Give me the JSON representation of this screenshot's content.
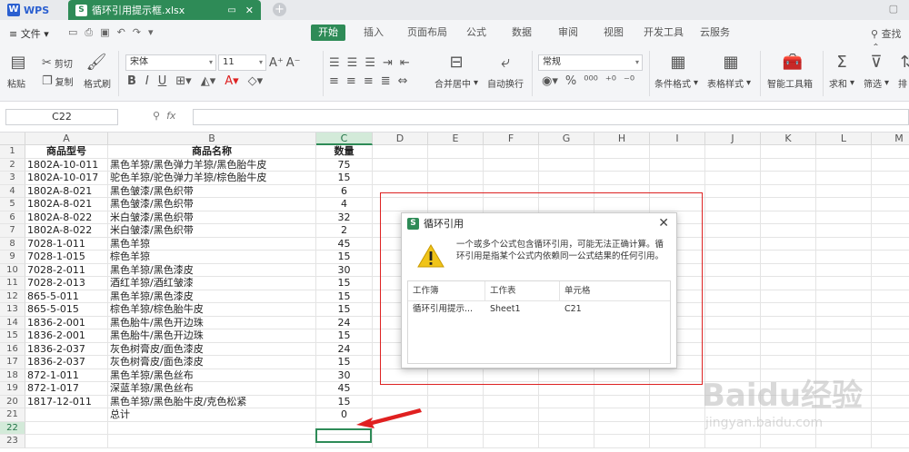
{
  "titlebar": {
    "app_name": "WPS",
    "doc_tab": "循环引用提示框.xlsx",
    "add_tab": "+"
  },
  "menubar": {
    "file": "文件",
    "tabs": [
      "开始",
      "插入",
      "页面布局",
      "公式",
      "数据",
      "审阅",
      "视图",
      "开发工具",
      "云服务"
    ],
    "active_tab": "开始",
    "search": "查找命"
  },
  "ribbon": {
    "cut": "剪切",
    "copy": "复制",
    "format_painter": "格式刷",
    "paste": "粘贴",
    "font_name": "宋体",
    "font_size": "11",
    "merge": "合并居中",
    "wrap": "自动换行",
    "number_format": "常规",
    "cond_format": "条件格式",
    "table_style": "表格样式",
    "smart_toolbox": "智能工具箱",
    "sum": "求和",
    "filter": "筛选",
    "sort": "排"
  },
  "formula_bar": {
    "name_box": "C22",
    "fx": "fx"
  },
  "sheet": {
    "columns": [
      "A",
      "B",
      "C",
      "D",
      "E",
      "F",
      "G",
      "H",
      "I",
      "J",
      "K",
      "L",
      "M"
    ],
    "row_numbers": [
      "1",
      "2",
      "3",
      "4",
      "5",
      "6",
      "7",
      "8",
      "9",
      "10",
      "11",
      "12",
      "13",
      "14",
      "15",
      "16",
      "17",
      "18",
      "19",
      "20",
      "21",
      "22",
      "23"
    ],
    "header": [
      "商品型号",
      "商品名称",
      "数量"
    ],
    "rows": [
      [
        "1802A-10-011",
        "黑色羊猄/黑色弹力羊猄/黑色胎牛皮",
        "75"
      ],
      [
        "1802A-10-017",
        "驼色羊猄/驼色弹力羊猄/棕色胎牛皮",
        "15"
      ],
      [
        "1802A-8-021",
        "黑色皱漆/黑色织带",
        "6"
      ],
      [
        "1802A-8-021",
        "黑色皱漆/黑色织带",
        "4"
      ],
      [
        "1802A-8-022",
        "米白皱漆/黑色织带",
        "32"
      ],
      [
        "1802A-8-022",
        "米白皱漆/黑色织带",
        "2"
      ],
      [
        "7028-1-011",
        "黑色羊猄",
        "45"
      ],
      [
        "7028-1-015",
        "棕色羊猄",
        "15"
      ],
      [
        "7028-2-011",
        "黑色羊猄/黑色漆皮",
        "30"
      ],
      [
        "7028-2-013",
        "酒红羊猄/酒红皱漆",
        "15"
      ],
      [
        "865-5-011",
        "黑色羊猄/黑色漆皮",
        "15"
      ],
      [
        "865-5-015",
        "棕色羊猄/棕色胎牛皮",
        "15"
      ],
      [
        "1836-2-001",
        "黑色胎牛/黑色开边珠",
        "24"
      ],
      [
        "1836-2-001",
        "黑色胎牛/黑色开边珠",
        "15"
      ],
      [
        "1836-2-037",
        "灰色树膏皮/面色漆皮",
        "24"
      ],
      [
        "1836-2-037",
        "灰色树膏皮/面色漆皮",
        "15"
      ],
      [
        "872-1-011",
        "黑色羊猄/黑色丝布",
        "30"
      ],
      [
        "872-1-017",
        "深蓝羊猄/黑色丝布",
        "45"
      ],
      [
        "1817-12-011",
        "黑色羊猄/黑色胎牛皮/克色松紧",
        "15"
      ]
    ],
    "total_label": "总计",
    "total_value": "0"
  },
  "dialog": {
    "title": "循环引用",
    "close": "✕",
    "message": "一个或多个公式包含循环引用，可能无法正确计算。循环引用是指某个公式内依赖同一公式结果的任何引用。",
    "table_headers": [
      "工作簿",
      "工作表",
      "单元格"
    ],
    "table_row": [
      "循环引用提示...",
      "Sheet1",
      "C21"
    ]
  },
  "watermark": {
    "text": "Baidu经验",
    "url": "jingyan.baidu.com"
  },
  "colors": {
    "accent_green": "#2e8b57",
    "annotation_red": "#dd2222"
  }
}
